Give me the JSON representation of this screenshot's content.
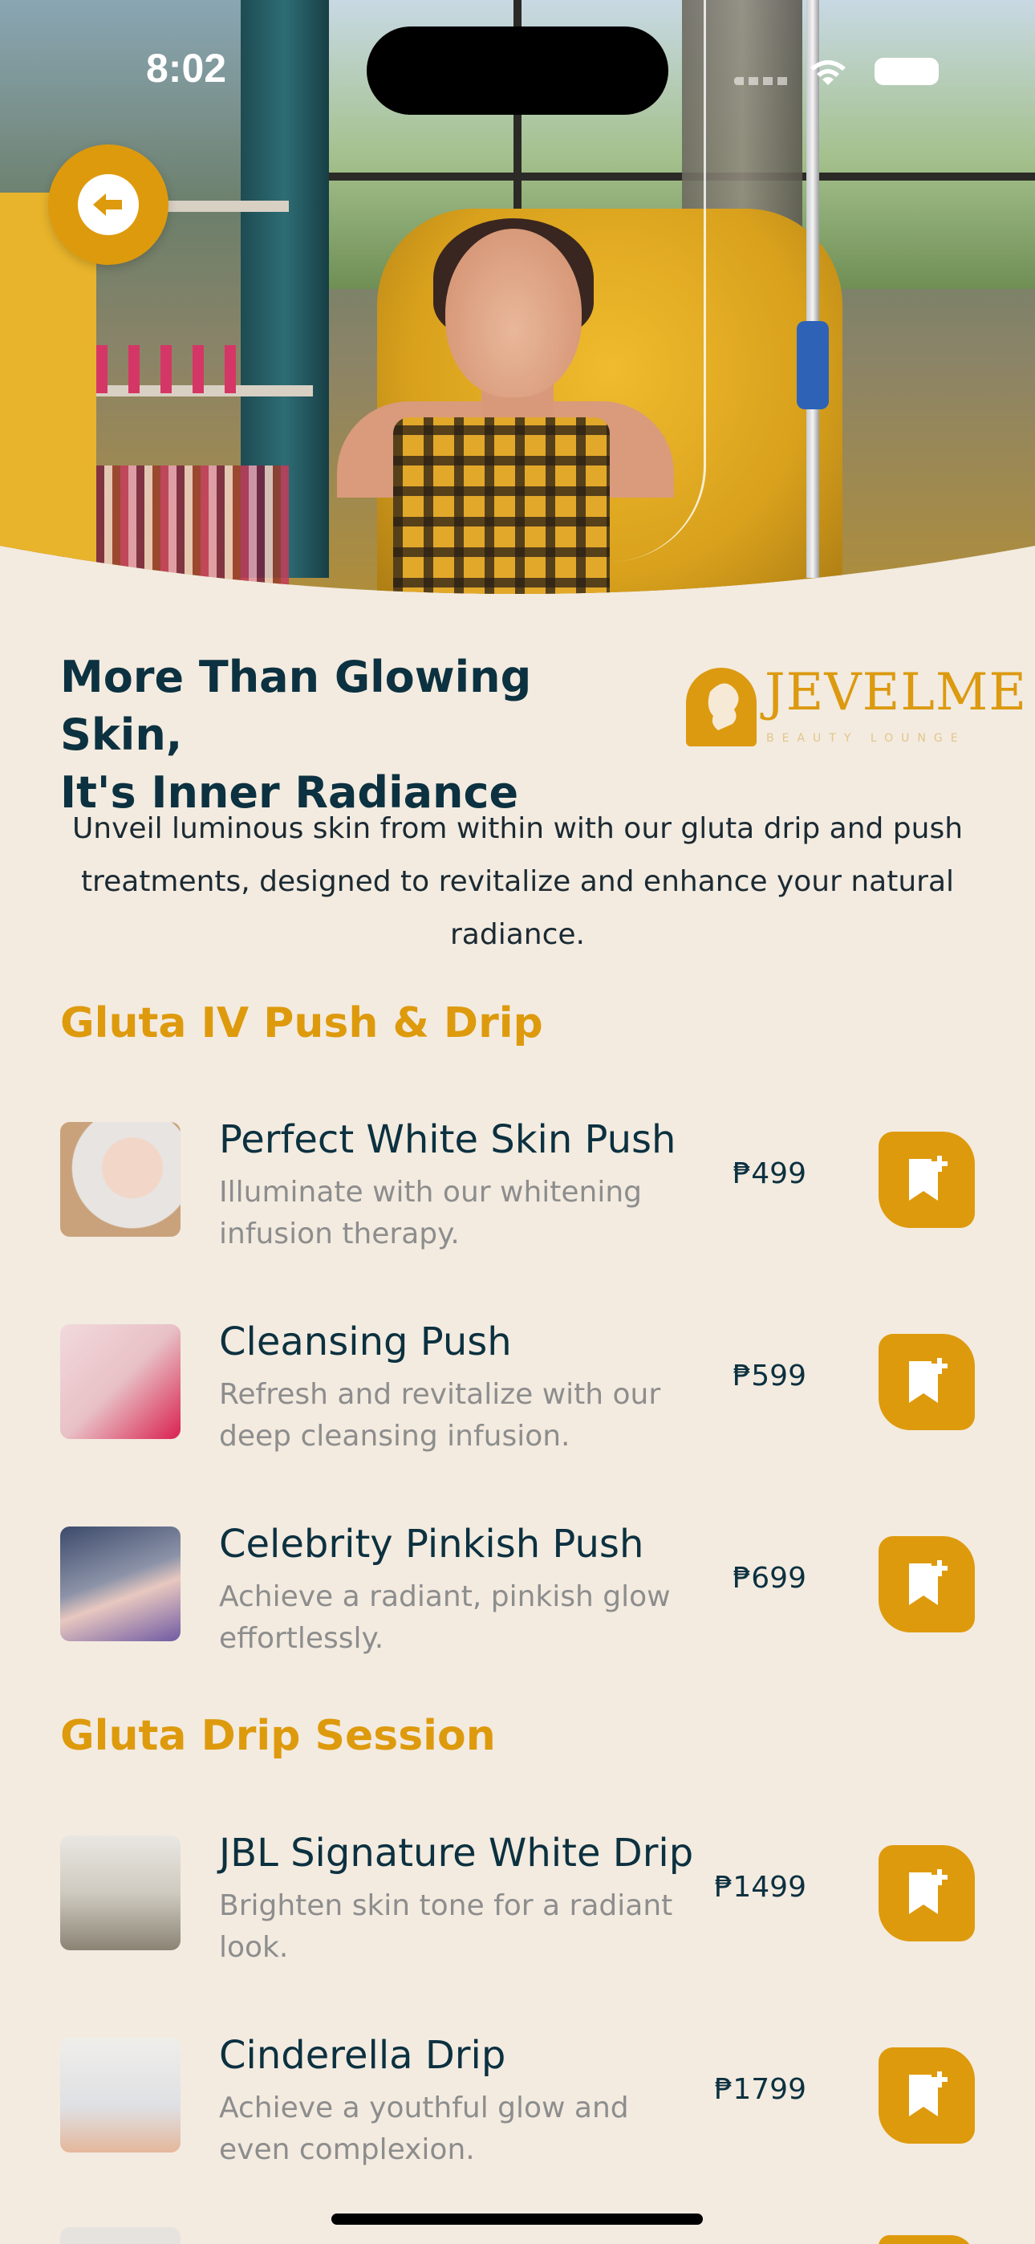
{
  "status_bar": {
    "time": "8:02"
  },
  "hero": {
    "image_icon": "salon-iv-photo"
  },
  "header": {
    "back_icon": "arrow-left-icon",
    "headline_line1": "More Than Glowing Skin,",
    "headline_line2": "It's Inner Radiance"
  },
  "logo": {
    "word": "JEVELME",
    "tagline": "BEAUTY LOUNGE"
  },
  "intro": "Unveil luminous skin from within with our gluta drip and push treatments, designed to revitalize and enhance your natural radiance.",
  "sections": [
    {
      "title": "Gluta IV Push & Drip",
      "items": [
        {
          "name": "Perfect White Skin Push",
          "desc": "Illuminate with our whitening infusion therapy.",
          "price": "₱499"
        },
        {
          "name": "Cleansing Push",
          "desc": "Refresh and revitalize with our deep cleansing infusion.",
          "price": "₱599"
        },
        {
          "name": "Celebrity Pinkish Push",
          "desc": "Achieve a radiant, pinkish glow effortlessly.",
          "price": "₱699"
        }
      ]
    },
    {
      "title": "Gluta Drip Session",
      "items": [
        {
          "name": "JBL Signature White Drip",
          "desc": "Brighten skin tone for a radiant look.",
          "price": "₱1499"
        },
        {
          "name": "Cinderella Drip",
          "desc": "Achieve a youthful glow and even complexion.",
          "price": "₱1799"
        }
      ]
    }
  ],
  "colors": {
    "accent": "#de9a0d",
    "text": "#0c3140",
    "background": "#f3ebe0",
    "muted": "#8d8d8d"
  },
  "icons": {
    "add": "bookmark-plus-icon"
  }
}
